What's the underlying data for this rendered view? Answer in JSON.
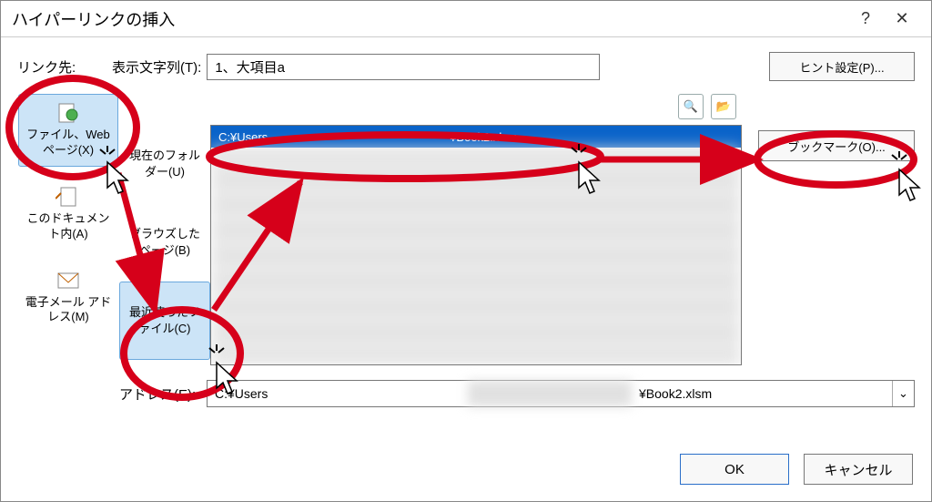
{
  "titlebar": {
    "title": "ハイパーリンクの挿入",
    "help": "?",
    "close": "✕"
  },
  "labels": {
    "link_to": "リンク先:",
    "display_text": "表示文字列(T):",
    "address": "アドレス(E):"
  },
  "fields": {
    "display_text_value": "1、大項目a",
    "address_prefix": "C:¥Users",
    "address_suffix": "¥Book2.xlsm"
  },
  "buttons": {
    "hint": "ヒント設定(P)...",
    "bookmark": "ブックマーク(O)...",
    "ok": "OK",
    "cancel": "キャンセル"
  },
  "places": [
    {
      "label": "ファイル、Web ページ(X)",
      "name": "place-file-web"
    },
    {
      "label": "このドキュメント内(A)",
      "name": "place-this-doc"
    },
    {
      "label": "電子メール アドレス(M)",
      "name": "place-email"
    }
  ],
  "subtabs": {
    "current_folder": "現在のフォルダー(U)",
    "browsed_pages": "ブラウズしたページ(B)",
    "recent_files": "最近使ったファイル(C)"
  },
  "list": {
    "selected_item_left": "C:¥Users",
    "selected_item_right": "¥Book2.xlsm"
  },
  "icons": {
    "web_search": "🔍",
    "open_folder": "📂",
    "dd_chevron": "⌄"
  }
}
